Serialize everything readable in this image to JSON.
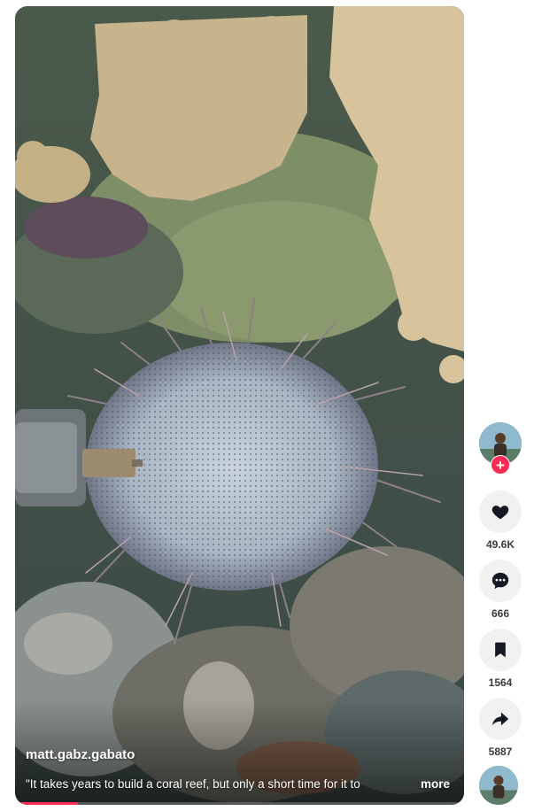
{
  "post": {
    "author": "matt.gabz.gabato",
    "caption": "\"It takes years to build a coral reef, but only a short time for it to",
    "more_label": "more",
    "progress": 0.14
  },
  "actions": {
    "follow_symbol": "+",
    "like": {
      "icon": "heart-icon",
      "count": "49.6K"
    },
    "comment": {
      "icon": "comment-icon",
      "count": "666"
    },
    "save": {
      "icon": "bookmark-icon",
      "count": "1564"
    },
    "share": {
      "icon": "share-icon",
      "count": "5887"
    }
  },
  "colors": {
    "accent": "#fe2c55",
    "icon": "#161823",
    "action_bg": "#f1f1f2"
  }
}
